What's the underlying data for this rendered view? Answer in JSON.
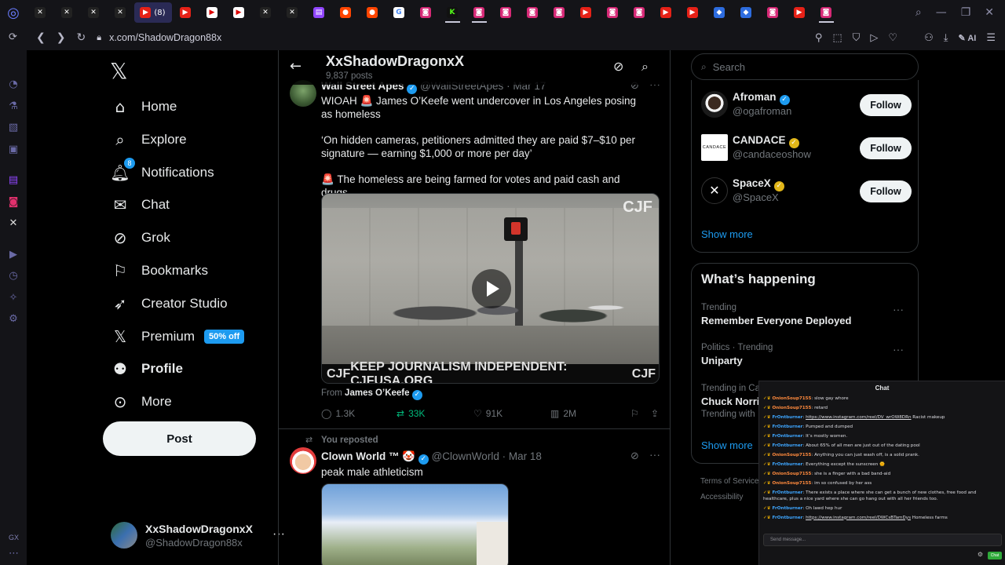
{
  "browser": {
    "url": "x.com/ShadowDragon88x",
    "active_tab_count": "(8)",
    "ai_label": "AI",
    "tab_icons": [
      "tab-x-icon",
      "tab-x-icon",
      "tab-x-icon",
      "tab-x-icon",
      "tab-youtube-icon",
      "tab-youtube-icon",
      "tab-flag-icon",
      "tab-flag-icon",
      "tab-x-icon",
      "tab-x-icon",
      "tab-twitch-icon",
      "tab-reddit-icon",
      "tab-reddit-icon",
      "tab-google-icon",
      "tab-instagram-icon",
      "tab-kick-icon",
      "tab-instagram-icon",
      "tab-instagram-icon",
      "tab-instagram-icon",
      "tab-instagram-icon",
      "tab-youtube-icon",
      "tab-instagram-icon",
      "tab-instagram-icon",
      "tab-youtube-icon",
      "tab-youtube-icon",
      "tab-app-icon",
      "tab-app-icon",
      "tab-instagram-icon",
      "tab-youtube-icon",
      "tab-instagram-icon"
    ],
    "sidebar_bottom_label": "GX"
  },
  "nav": {
    "items": [
      {
        "label": "Home"
      },
      {
        "label": "Explore"
      },
      {
        "label": "Notifications",
        "badge": "8"
      },
      {
        "label": "Chat"
      },
      {
        "label": "Grok"
      },
      {
        "label": "Bookmarks"
      },
      {
        "label": "Creator Studio"
      },
      {
        "label": "Premium",
        "promo": "50% off"
      },
      {
        "label": "Profile"
      },
      {
        "label": "More"
      }
    ],
    "post_label": "Post",
    "account": {
      "display_name": "XxShadowDragonxX",
      "handle": "@ShadowDragon88x"
    }
  },
  "header": {
    "title": "XxShadowDragonxX",
    "posts_count": "9,837 posts"
  },
  "tweet1": {
    "author": "Wall Street Apes",
    "handle": "@WallStreetApes",
    "date": "Mar 17",
    "line1": "WIOAH 🚨 James O’Keefe went undercover in Los Angeles posing as homeless",
    "line2": "‘On hidden cameras, petitioners admitted they are paid $7–$10 per signature — earning $1,000 or more per day’",
    "line3": "🚨 The homeless are being farmed for votes and paid cash and drugs",
    "media_banner_left": "CJF",
    "media_banner_text": "KEEP JOURNALISM INDEPENDENT: CJFUSA.ORG",
    "media_banner_right": "CJF",
    "media_watermark": "CJF",
    "from_prefix": "From",
    "from_name": "James O’Keefe",
    "replies": "1.3K",
    "reposts": "33K",
    "likes": "91K",
    "views": "2M"
  },
  "tweet2": {
    "repost_label": "You reposted",
    "author": "Clown World ™ 🤡",
    "handle": "@ClownWorld",
    "date": "Mar 18",
    "text": "peak male athleticism"
  },
  "search": {
    "placeholder": "Search"
  },
  "who_to_follow": {
    "accounts": [
      {
        "name": "Afroman",
        "handle": "@ogafroman",
        "verified": "blue"
      },
      {
        "name": "CANDACE",
        "handle": "@candaceoshow",
        "verified": "gold",
        "avatar_text": "CANDACE"
      },
      {
        "name": "SpaceX",
        "handle": "@SpaceX",
        "verified": "gold"
      }
    ],
    "follow_label": "Follow",
    "show_more": "Show more"
  },
  "happening": {
    "title": "What’s happening",
    "trends": [
      {
        "meta": "Trending",
        "topic": "Remember Everyone Deployed"
      },
      {
        "meta": "Politics · Trending",
        "topic": "Uniparty"
      },
      {
        "meta": "Trending in Ca",
        "topic": "Chuck Norri",
        "sub": "Trending with"
      }
    ],
    "show_more": "Show more"
  },
  "footer": {
    "terms": "Terms of Service",
    "accessibility": "Accessibility"
  },
  "chat": {
    "title": "Chat",
    "messages": [
      {
        "user": "OnionSoup7155",
        "sep": ": ",
        "text": "slow gay whore",
        "color": "orange"
      },
      {
        "user": "OnionSoup7155",
        "sep": ": ",
        "text": "retard",
        "color": "orange"
      },
      {
        "user": "FrOntburner",
        "sep": ": ",
        "link": "https://www.instagram.com/reel/DV_wrOW8DRn",
        "text": " Racist makeup",
        "color": "blue"
      },
      {
        "user": "FrOntburner",
        "sep": ": ",
        "text": "Pumped and dumped",
        "color": "blue"
      },
      {
        "user": "FrOntburner",
        "sep": ": ",
        "text": "It’s mostly women.",
        "color": "blue"
      },
      {
        "user": "FrOntburner",
        "sep": ": ",
        "text": "About 65% of all men are just out of the dating pool",
        "color": "blue"
      },
      {
        "user": "OnionSoup7155",
        "sep": ": ",
        "text": "Anything you can just wash off, is a solid prank.",
        "color": "orange"
      },
      {
        "user": "FrOntburner",
        "sep": ": ",
        "text": "Everything except the sunscreen 🌞",
        "color": "blue"
      },
      {
        "user": "OnionSoup7155",
        "sep": ": ",
        "text": "she is a finger with a bad band-aid",
        "color": "orange"
      },
      {
        "user": "OnionSoup7155",
        "sep": ": ",
        "text": "im so confused by her ass",
        "color": "orange"
      },
      {
        "user": "FrOntburner",
        "sep": ": ",
        "text": "There exists a place where she can get a bunch of new clothes, free food and healthcare, plus a nice yard where she can go hang out with all her friends too.",
        "color": "blue"
      },
      {
        "user": "FrOntburner",
        "sep": ": ",
        "text": "Oh lawd hep hur",
        "color": "blue"
      },
      {
        "user": "FrOntburner",
        "sep": ": ",
        "link": "https://www.instagram.com/reel/DWCsBTamDys",
        "text": " Homeless farms",
        "color": "blue"
      }
    ],
    "input_placeholder": "Send message...",
    "send_label": "Chat"
  }
}
